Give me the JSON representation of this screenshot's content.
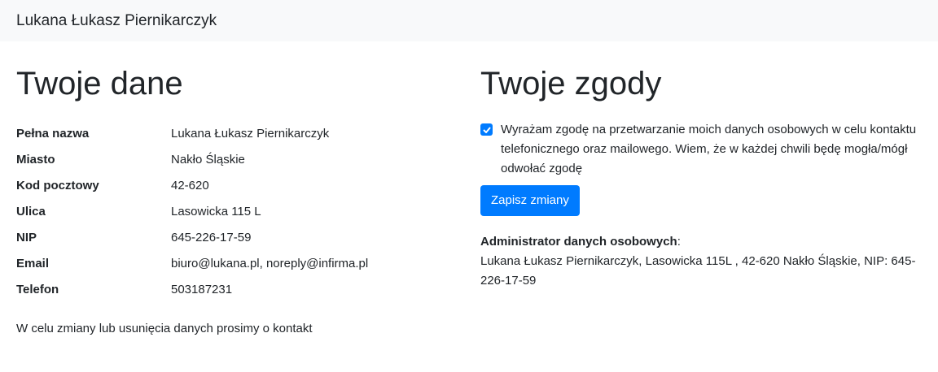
{
  "navbar": {
    "brand": "Lukana Łukasz Piernikarczyk"
  },
  "left": {
    "title": "Twoje dane",
    "rows": [
      {
        "label": "Pełna nazwa",
        "value": "Lukana Łukasz Piernikarczyk"
      },
      {
        "label": "Miasto",
        "value": "Nakło Śląskie"
      },
      {
        "label": "Kod pocztowy",
        "value": "42-620"
      },
      {
        "label": "Ulica",
        "value": "Lasowicka 115 L"
      },
      {
        "label": "NIP",
        "value": "645-226-17-59"
      },
      {
        "label": "Email",
        "value": "biuro@lukana.pl, noreply@infirma.pl"
      },
      {
        "label": "Telefon",
        "value": "503187231"
      }
    ],
    "note": "W celu zmiany lub usunięcia danych prosimy o kontakt"
  },
  "right": {
    "title": "Twoje zgody",
    "consent_checked": true,
    "consent_text": "Wyrażam zgodę na przetwarzanie moich danych osobowych w celu kontaktu telefonicznego oraz mailowego. Wiem, że w każdej chwili będę mogła/mógł odwołać zgodę",
    "save_label": "Zapisz zmiany",
    "admin_title": "Administrator danych osobowych",
    "admin_colon": ":",
    "admin_text": "Lukana Łukasz Piernikarczyk, Lasowicka 115L , 42-620 Nakło Śląskie, NIP: 645-226-17-59"
  },
  "colors": {
    "accent": "#007bff",
    "navbar_bg": "#f8f9fa",
    "text": "#212529"
  }
}
